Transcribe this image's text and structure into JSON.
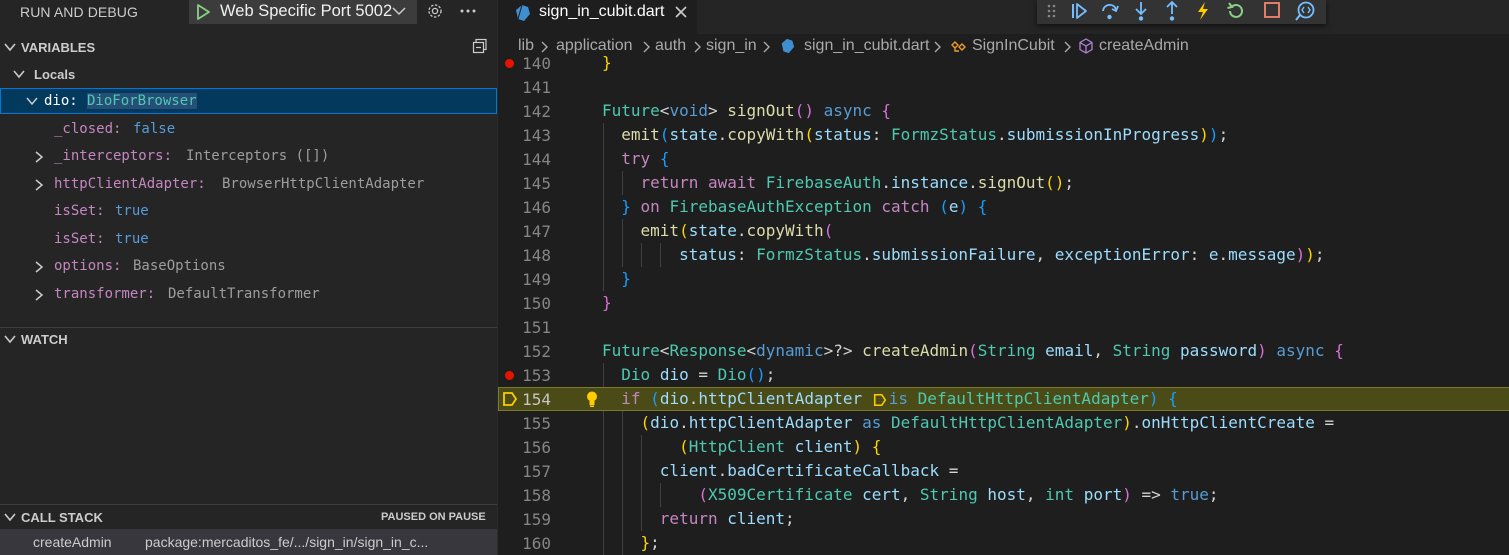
{
  "sidebar": {
    "title": "RUN AND DEBUG",
    "launch_config": "Web Specific Port 5002",
    "variables_header": "VARIABLES",
    "locals_header": "Locals",
    "variables": [
      {
        "name": "dio:",
        "value": "DioForBrowser"
      },
      {
        "name": "_closed:",
        "value": "false"
      },
      {
        "name": "_interceptors:",
        "value": "Interceptors ([])"
      },
      {
        "name": "httpClientAdapter:",
        "value": "BrowserHttpClientAdapter"
      },
      {
        "name": "isSet:",
        "value": "true"
      },
      {
        "name": "isSet:",
        "value": "true"
      },
      {
        "name": "options:",
        "value": "BaseOptions"
      },
      {
        "name": "transformer:",
        "value": "DefaultTransformer"
      }
    ],
    "watch_header": "WATCH",
    "callstack_header": "CALL STACK",
    "callstack_status": "PAUSED ON PAUSE",
    "callstack_frames": [
      {
        "function": "createAdmin",
        "source": "package:mercaditos_fe/.../sign_in/sign_in_c..."
      }
    ]
  },
  "editor": {
    "tab_label": "sign_in_cubit.dart",
    "breadcrumb": [
      "lib",
      "application",
      "auth",
      "sign_in",
      "sign_in_cubit.dart",
      "SignInCubit",
      "createAdmin"
    ],
    "current_line": 154,
    "breakpoint_lines": [
      140,
      153
    ],
    "line_numbers": [
      "140",
      "141",
      "142",
      "143",
      "144",
      "145",
      "146",
      "147",
      "148",
      "149",
      "150",
      "151",
      "152",
      "153",
      "154",
      "155",
      "156",
      "157",
      "158",
      "159",
      "160"
    ]
  },
  "icons": {
    "launch": "play-icon",
    "settings": "gear-icon",
    "more": "ellipsis-icon",
    "collapse_all": "collapse-all-icon",
    "debug_toolbar": [
      "drag-handle-icon",
      "continue-icon",
      "step-over-icon",
      "step-into-icon",
      "step-out-icon",
      "hot-reload-icon",
      "restart-icon",
      "stop-icon",
      "devtools-icon"
    ]
  },
  "colors": {
    "accent": "#0078d4",
    "breakpoint": "#e51400",
    "current_line": "#4b4b18"
  }
}
